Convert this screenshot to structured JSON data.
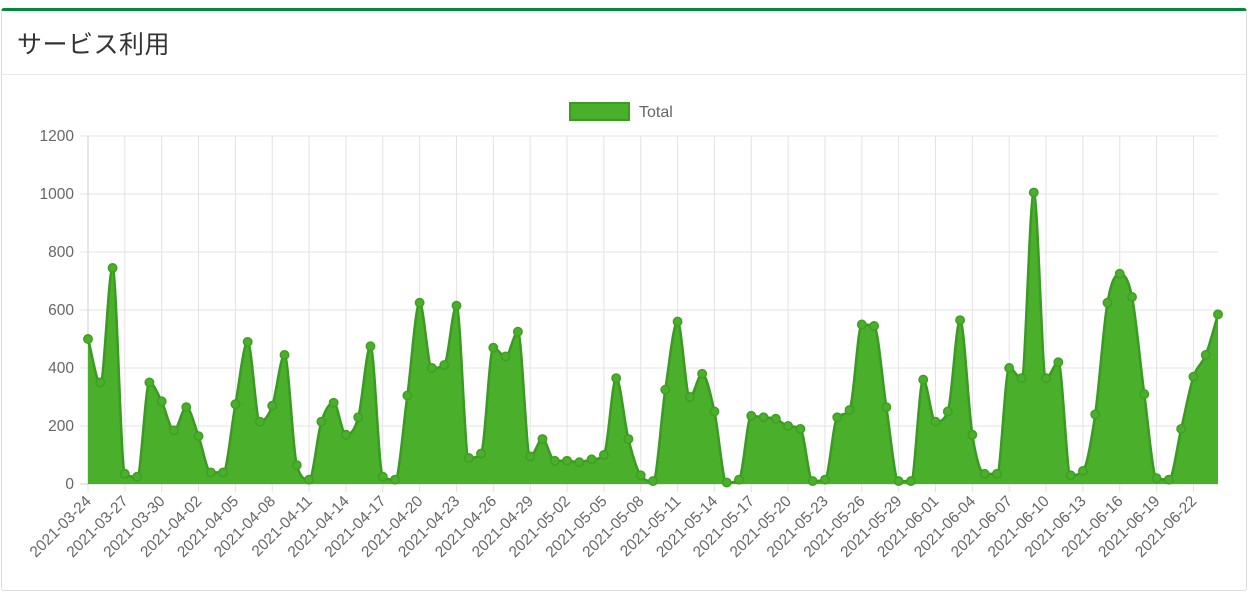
{
  "panel": {
    "title": "サービス利用"
  },
  "colors": {
    "accent": "#00883c",
    "fill": "#4aaf2a",
    "stroke": "#3a9a22",
    "grid": "#e3e3e3"
  },
  "chart_data": {
    "type": "area",
    "legend": {
      "position": "top",
      "entries": [
        "Total"
      ]
    },
    "grid": true,
    "ylim": [
      0,
      1200
    ],
    "yticks": [
      0,
      200,
      400,
      600,
      800,
      1000,
      1200
    ],
    "x_start": "2021-03-24",
    "x_end": "2021-06-24",
    "xtick_labels": [
      "2021-03-24",
      "2021-03-27",
      "2021-03-30",
      "2021-04-02",
      "2021-04-05",
      "2021-04-08",
      "2021-04-11",
      "2021-04-14",
      "2021-04-17",
      "2021-04-20",
      "2021-04-23",
      "2021-04-26",
      "2021-04-29",
      "2021-05-02",
      "2021-05-05",
      "2021-05-08",
      "2021-05-11",
      "2021-05-14",
      "2021-05-17",
      "2021-05-20",
      "2021-05-23",
      "2021-05-26",
      "2021-05-29",
      "2021-06-01",
      "2021-06-04",
      "2021-06-07",
      "2021-06-10",
      "2021-06-13",
      "2021-06-16",
      "2021-06-19",
      "2021-06-22"
    ],
    "series": [
      {
        "name": "Total",
        "values": [
          500,
          350,
          745,
          35,
          25,
          350,
          285,
          185,
          265,
          165,
          40,
          40,
          275,
          490,
          215,
          270,
          445,
          65,
          15,
          215,
          280,
          170,
          230,
          475,
          25,
          15,
          305,
          625,
          400,
          410,
          615,
          90,
          105,
          470,
          440,
          525,
          95,
          155,
          80,
          80,
          75,
          85,
          100,
          365,
          155,
          30,
          10,
          325,
          560,
          300,
          380,
          250,
          5,
          15,
          235,
          230,
          225,
          200,
          190,
          10,
          15,
          230,
          255,
          550,
          545,
          265,
          10,
          10,
          360,
          215,
          250,
          565,
          170,
          35,
          35,
          400,
          365,
          1005,
          365,
          420,
          30,
          45,
          240,
          625,
          725,
          645,
          310,
          20,
          15,
          190,
          370,
          445,
          585
        ]
      }
    ]
  }
}
